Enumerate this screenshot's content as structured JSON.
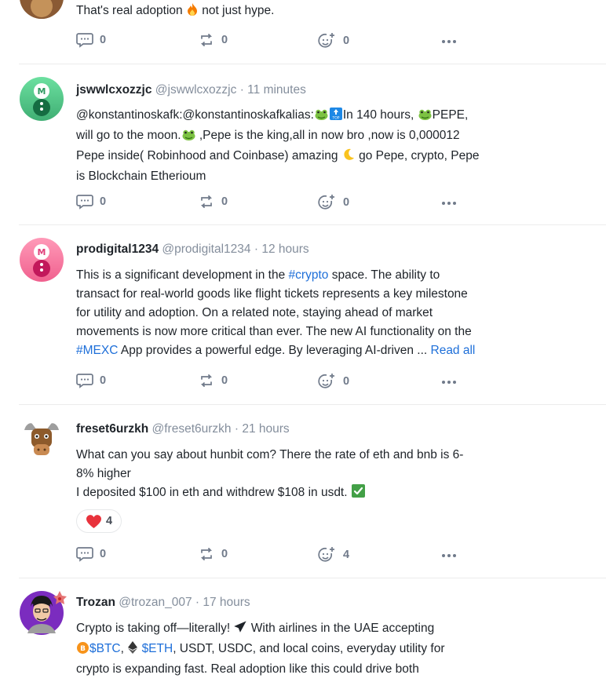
{
  "posts": [
    {
      "body_text": "That's real adoption",
      "body_text_2": "not just hype.",
      "comments": "0",
      "reposts": "0",
      "reactions": "0"
    },
    {
      "username": "jswwlcxozzjc",
      "handle": "@jswwlcxozzjc",
      "separator": "·",
      "time": "11 minutes",
      "p1": "@konstantinoskafk:@konstantinoskafkalias:",
      "p2": "In 140 hours,",
      "p3": "PEPE,",
      "line2a": "will go to the moon.",
      "line2b": ",Pepe is the king,all in now bro ,now is 0,000012",
      "line3a": "Pepe inside( Robinhood and Coinbase) amazing",
      "line3b": "go Pepe, crypto, Pepe",
      "line4": "is Blockchain Etherioum",
      "comments": "0",
      "reposts": "0",
      "reactions": "0"
    },
    {
      "username": "prodigital1234",
      "handle": "@prodigital1234",
      "separator": "·",
      "time": "12 hours",
      "l1a": "This is a significant development in the",
      "tag1": "#crypto",
      "l1b": "space. The ability to",
      "l2": "transact for real-world goods like flight tickets represents a key milestone",
      "l3": "for utility and adoption. On a related note, staying ahead of market",
      "l4": "movements is now more critical than ever. The new AI functionality on the",
      "tag2": "#MEXC",
      "l5": "App provides a powerful edge. By leveraging AI-driven",
      "ellipsis": "...",
      "read_all": "Read all",
      "comments": "0",
      "reposts": "0",
      "reactions": "0"
    },
    {
      "username": "freset6urzkh",
      "handle": "@freset6urzkh",
      "separator": "·",
      "time": "21 hours",
      "l1": "What can you say about hunbit com? There the rate of eth and bnb is 6-",
      "l2": "8% higher",
      "l3": "I deposited $100 in eth and withdrew $108 in usdt.",
      "heart_count": "4",
      "comments": "0",
      "reposts": "0",
      "reactions": "4"
    },
    {
      "username": "Trozan",
      "handle": "@trozan_007",
      "separator": "·",
      "time": "17 hours",
      "l1a": "Crypto is taking off—literally!",
      "l1b": "With airlines in the UAE accepting",
      "btc": "$BTC",
      "comma": ",",
      "eth": "$ETH",
      "l2b": ", USDT, USDC, and local coins, everyday utility for",
      "l3": "crypto is expanding fast. Real adoption like this could drive both"
    }
  ],
  "colors": {
    "link": "#1e6fd9",
    "muted": "#848e9c",
    "heart": "#e8323c"
  }
}
